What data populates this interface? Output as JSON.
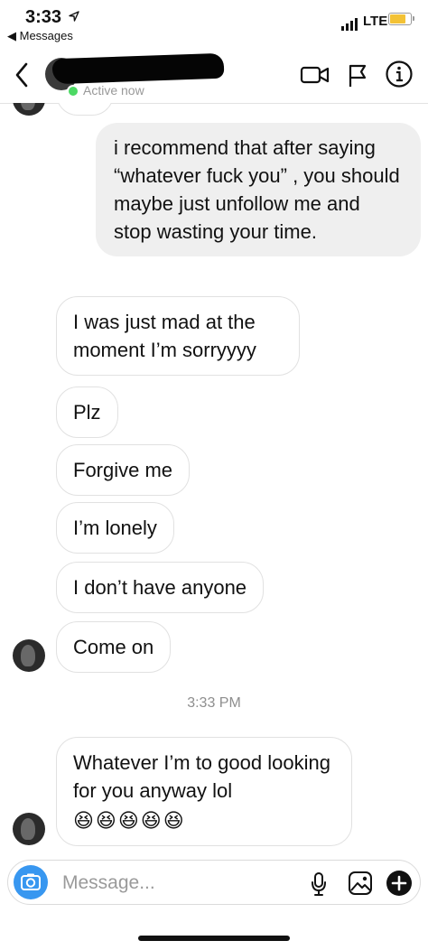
{
  "status_bar": {
    "time": "3:33",
    "back_app": "◀ Messages",
    "network": "LTE"
  },
  "header": {
    "status": "Active now"
  },
  "messages": [
    {
      "side": "out",
      "text": "i recommend that after saying “whatever fuck you” , you should maybe just unfollow me and stop wasting your time."
    },
    {
      "side": "in",
      "text": "I was just mad at the moment I’m sorryyyy"
    },
    {
      "side": "in",
      "text": "Plz"
    },
    {
      "side": "in",
      "text": "Forgive me"
    },
    {
      "side": "in",
      "text": "I’m lonely"
    },
    {
      "side": "in",
      "text": "I don’t have anyone"
    },
    {
      "side": "in",
      "text": "Come on"
    },
    {
      "side": "in",
      "text": "Whatever I’m to good looking for you anyway lol",
      "emoji": "😆😆😆😆😆"
    }
  ],
  "timestamp": "3:33 PM",
  "composer": {
    "placeholder": "Message..."
  },
  "icons": [
    "location-arrow-icon",
    "signal-bars-icon",
    "battery-icon",
    "back-chevron-icon",
    "video-call-icon",
    "flag-icon",
    "info-icon",
    "camera-icon",
    "microphone-icon",
    "gallery-icon",
    "plus-icon"
  ],
  "colors": {
    "outgoing_bubble": "#efefef",
    "incoming_border": "#e1e1e1",
    "camera_button": "#3897f0",
    "online_dot": "#4cd964",
    "battery": "#f3c236"
  }
}
